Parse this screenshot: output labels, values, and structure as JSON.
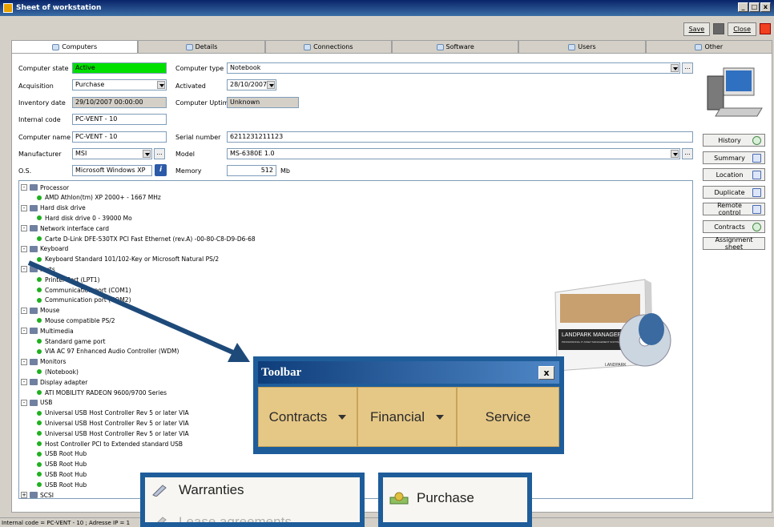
{
  "window": {
    "title": "Sheet of workstation",
    "buttons": [
      "_",
      "□",
      "x"
    ]
  },
  "topbar": {
    "save_label": "Save",
    "close_label": "Close"
  },
  "tabs": [
    {
      "label": "Computers"
    },
    {
      "label": "Details"
    },
    {
      "label": "Connections"
    },
    {
      "label": "Software"
    },
    {
      "label": "Users"
    },
    {
      "label": "Other"
    }
  ],
  "form": {
    "computer_state_label": "Computer state",
    "computer_state": "Active",
    "acquisition_label": "Acquisition",
    "acquisition": "Purchase",
    "inventory_date_label": "Inventory date",
    "inventory_date": "29/10/2007 00:00:00",
    "internal_code_label": "Internal code",
    "internal_code": "PC-VENT - 10",
    "computer_name_label": "Computer name",
    "computer_name": "PC-VENT - 10",
    "manufacturer_label": "Manufacturer",
    "manufacturer": "MSI",
    "os_label": "O.S.",
    "os": "Microsoft Windows XP",
    "computer_type_label": "Computer type",
    "computer_type": "Notebook",
    "activated_label": "Activated",
    "activated": "28/10/2007",
    "uptime_label": "Computer Uptime",
    "uptime": "Unknown",
    "serial_label": "Serial number",
    "serial": "6211231211123",
    "model_label": "Model",
    "model": "MS-6380E 1.0",
    "memory_label": "Memory",
    "memory": "512",
    "memory_unit": "Mb",
    "ellipsis": "...",
    "info": "i"
  },
  "side_buttons": [
    {
      "label": "History"
    },
    {
      "label": "Summary"
    },
    {
      "label": "Location"
    },
    {
      "label": "Duplicate"
    },
    {
      "label": "Remote control"
    },
    {
      "label": "Contracts"
    },
    {
      "label": "Assignment sheet"
    }
  ],
  "tree": [
    {
      "label": "Processor",
      "cat": true,
      "exp": "-"
    },
    {
      "label": "AMD Athlon(tm) XP 2000+ - 1667 MHz"
    },
    {
      "label": "Hard disk drive",
      "cat": true,
      "exp": "-"
    },
    {
      "label": "Hard disk drive 0 - 39000 Mo"
    },
    {
      "label": "Network interface card",
      "cat": true,
      "exp": "-"
    },
    {
      "label": "Carte D-Link DFE-530TX PCI Fast Ethernet (rev.A) -00-80-C8-D9-D6-68"
    },
    {
      "label": "Keyboard",
      "cat": true,
      "exp": "-"
    },
    {
      "label": "Keyboard Standard 101/102-Key or Microsoft Natural PS/2"
    },
    {
      "label": "Ports",
      "cat": true,
      "exp": "-"
    },
    {
      "label": "Printer Port (LPT1)"
    },
    {
      "label": "Communication port (COM1)"
    },
    {
      "label": "Communication port (COM2)"
    },
    {
      "label": "Mouse",
      "cat": true,
      "exp": "-"
    },
    {
      "label": "Mouse compatible PS/2"
    },
    {
      "label": "Multimedia",
      "cat": true,
      "exp": "-"
    },
    {
      "label": "Standard game port"
    },
    {
      "label": "VIA AC 97 Enhanced Audio Controller (WDM)"
    },
    {
      "label": "Monitors",
      "cat": true,
      "exp": "-"
    },
    {
      "label": "(Notebook)"
    },
    {
      "label": "Display adapter",
      "cat": true,
      "exp": "-"
    },
    {
      "label": "ATI MOBILITY RADEON 9600/9700 Series"
    },
    {
      "label": "USB",
      "cat": true,
      "exp": "-"
    },
    {
      "label": "Universal USB Host Controller Rev 5 or later VIA"
    },
    {
      "label": "Universal USB Host Controller Rev 5 or later VIA"
    },
    {
      "label": "Universal USB Host Controller Rev 5 or later VIA"
    },
    {
      "label": "Host Controller PCI to Extended standard USB"
    },
    {
      "label": "USB Root Hub"
    },
    {
      "label": "USB Root Hub"
    },
    {
      "label": "USB Root Hub"
    },
    {
      "label": "USB Root Hub"
    },
    {
      "label": "SCSI",
      "cat": true,
      "exp": "+"
    }
  ],
  "product": {
    "title": "LANDPARK MANAGER",
    "subtitle": "PROFESSIONAL IT ASSET MANAGEMENT SOFTWARE",
    "brand": "LANDPARK"
  },
  "callout_toolbar": {
    "title": "Toolbar",
    "close": "x",
    "buttons": [
      {
        "label": "Contracts",
        "dropdown": true
      },
      {
        "label": "Financial",
        "dropdown": true
      },
      {
        "label": "Service",
        "dropdown": false
      }
    ]
  },
  "callout_menu1": {
    "items": [
      "Warranties",
      "Lease agreements"
    ]
  },
  "callout_menu2": {
    "items": [
      "Purchase"
    ]
  },
  "statusbar": {
    "text": "Internal code = PC-VENT - 10 ; Adresse IP = 1"
  },
  "colors": {
    "title_bar": "#0a246a",
    "state_active": "#00e000",
    "callout_frame": "#1e5d9a",
    "toolbar_button": "#e6c886"
  }
}
